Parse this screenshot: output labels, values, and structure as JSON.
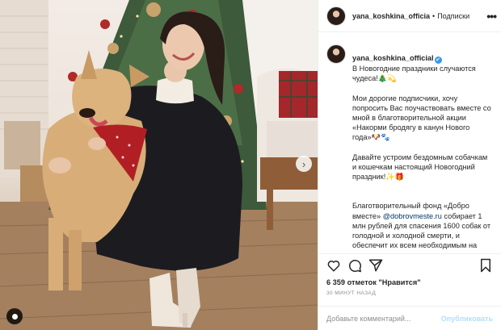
{
  "post": {
    "username": "yana_koshkina_officia",
    "follow_separator": "•",
    "follow_label": "Подписки",
    "more_label": "•••"
  },
  "caption": {
    "username": "yana_koshkina_official",
    "verified_mark": "✔",
    "lead": "В Новогодние праздники случаются чудеса!🎄💫",
    "paragraph_2": "Мои дорогие подписчики, хочу попросить Вас поучаствовать вместе со мной в благотворительной акции «Накорми бродягу в канун Нового года»🐶🐾",
    "paragraph_3": "Давайте устроим бездомным собачкам и кошечкам настоящий Новогодний праздник!✨🎁",
    "paragraph_4_start": "Благотворительный фонд «Добро вместе» ",
    "paragraph_4_link": "@dobrovmeste.ru",
    "paragraph_4_end": " собирает 1 млн рублей для спасения 1600 собак от голодной и холодной смерти, и обеспечит их всем необходимым на время новогодних"
  },
  "actions": {
    "like_icon": "heart-icon",
    "comment_icon": "comment-icon",
    "share_icon": "share-icon",
    "save_icon": "bookmark-icon"
  },
  "likes": {
    "count": "6 359",
    "text": "отметок \"Нравится\""
  },
  "timestamp": "30 МИНУТ НАЗАД",
  "comment": {
    "placeholder": "Добавьте комментарий...",
    "value": "",
    "publish_label": "Опубликовать"
  },
  "photo": {
    "next_icon": "chevron-right-icon",
    "tag_icon": "user-tag-icon"
  },
  "colors": {
    "link": "#00376b",
    "verified": "#3897f0",
    "publish_disabled": "#b2dffc",
    "muted": "#8e8e8e"
  }
}
